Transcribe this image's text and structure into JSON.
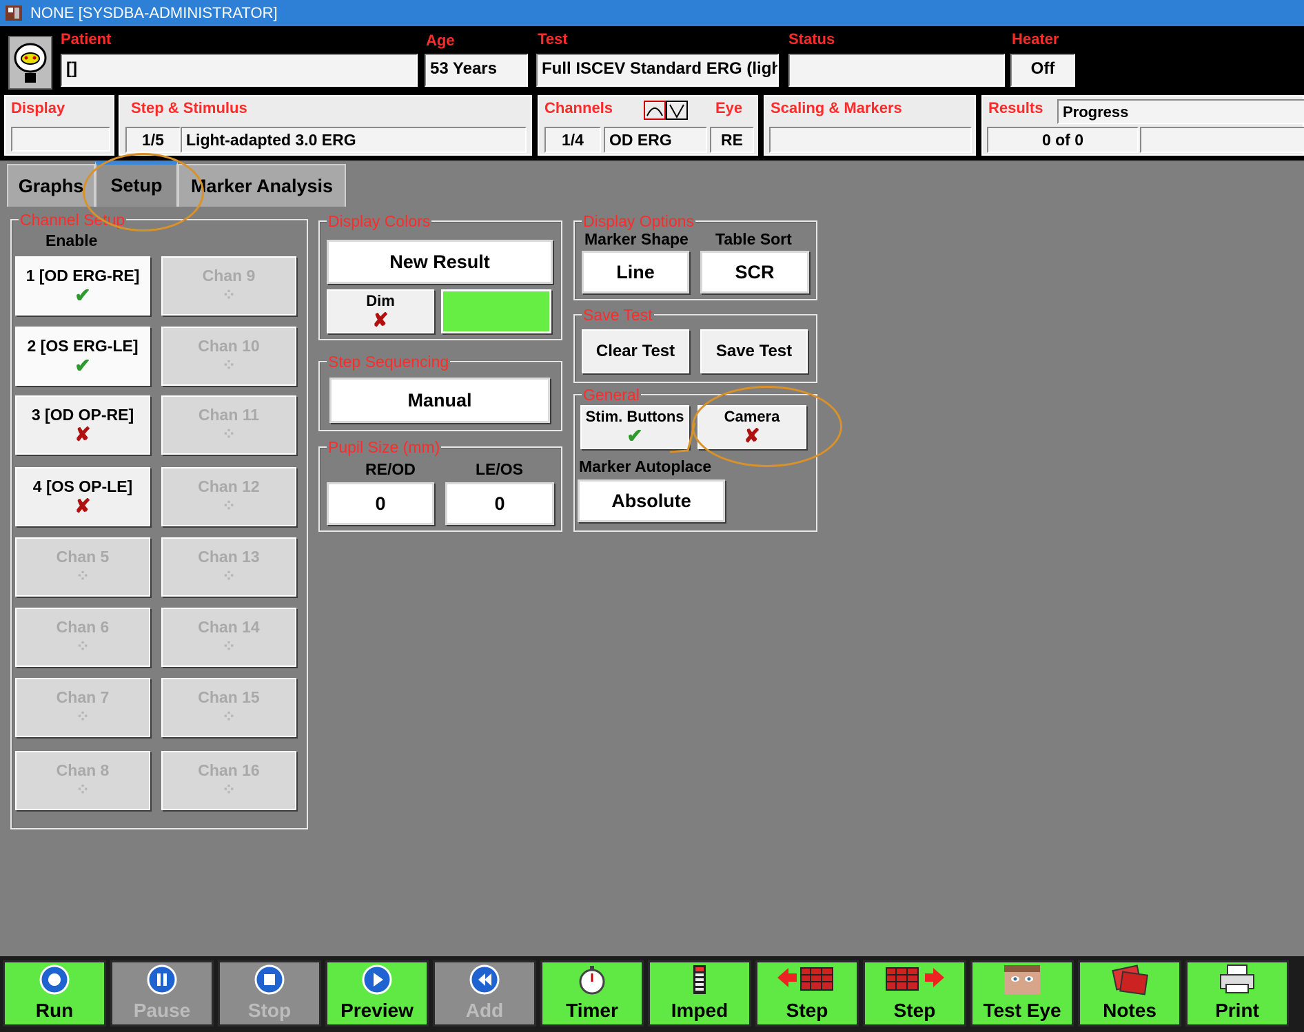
{
  "window": {
    "title": "NONE [SYSDBA-ADMINISTRATOR]"
  },
  "header": {
    "patient_label": "Patient",
    "patient_value": "[]",
    "age_label": "Age",
    "age_value": "53 Years",
    "test_label": "Test",
    "test_value": "Full ISCEV Standard ERG (ligh",
    "status_label": "Status",
    "status_value": "",
    "heater_label": "Heater",
    "heater_value": "Off",
    "display_label": "Display",
    "display_value": "",
    "step_label": "Step & Stimulus",
    "step_index": "1/5",
    "step_value": "Light-adapted 3.0 ERG",
    "channels_label": "Channels",
    "channel_index": "1/4",
    "channel_value": "OD ERG",
    "eye_label": "Eye",
    "eye_value": "RE",
    "scaling_label": "Scaling & Markers",
    "scaling_value": "",
    "results_label": "Results",
    "progress_label": "Progress",
    "results_value": "0 of 0",
    "results_extra": ""
  },
  "tabs": [
    {
      "label": "Graphs"
    },
    {
      "label": "Setup"
    },
    {
      "label": "Marker Analysis"
    }
  ],
  "channel_setup": {
    "title": "Channel Setup",
    "enable_label": "Enable",
    "left": [
      {
        "label": "1 [OD ERG-RE]",
        "state": "✔"
      },
      {
        "label": "2 [OS ERG-LE]",
        "state": "✔"
      },
      {
        "label": "3 [OD OP-RE]",
        "state": "✘"
      },
      {
        "label": "4 [OS OP-LE]",
        "state": "✘"
      },
      {
        "label": "Chan 5",
        "state": "⁘"
      },
      {
        "label": "Chan 6",
        "state": "⁘"
      },
      {
        "label": "Chan 7",
        "state": "⁘"
      },
      {
        "label": "Chan 8",
        "state": "⁘"
      }
    ],
    "right": [
      {
        "label": "Chan 9",
        "state": "⁘"
      },
      {
        "label": "Chan 10",
        "state": "⁘"
      },
      {
        "label": "Chan 11",
        "state": "⁘"
      },
      {
        "label": "Chan 12",
        "state": "⁘"
      },
      {
        "label": "Chan 13",
        "state": "⁘"
      },
      {
        "label": "Chan 14",
        "state": "⁘"
      },
      {
        "label": "Chan 15",
        "state": "⁘"
      },
      {
        "label": "Chan 16",
        "state": "⁘"
      }
    ]
  },
  "display_colors": {
    "title": "Display Colors",
    "new_result": "New Result",
    "dim_label": "Dim",
    "dim_state": "✘",
    "swatch_color": "#66ee44"
  },
  "step_sequencing": {
    "title": "Step Sequencing",
    "value": "Manual"
  },
  "pupil_size": {
    "title": "Pupil Size (mm)",
    "re_label": "RE/OD",
    "le_label": "LE/OS",
    "re_value": "0",
    "le_value": "0"
  },
  "display_options": {
    "title": "Display Options",
    "marker_shape_label": "Marker Shape",
    "marker_shape_value": "Line",
    "table_sort_label": "Table Sort",
    "table_sort_value": "SCR"
  },
  "save_test": {
    "title": "Save Test",
    "clear_label": "Clear Test",
    "save_label": "Save Test"
  },
  "general": {
    "title": "General",
    "stim_label": "Stim. Buttons",
    "stim_state": "✔",
    "camera_label": "Camera",
    "camera_state": "✘",
    "marker_autoplace_label": "Marker Autoplace",
    "marker_autoplace_value": "Absolute"
  },
  "toolbar": [
    {
      "label": "Run",
      "icon": "run-icon",
      "enabled": true
    },
    {
      "label": "Pause",
      "icon": "pause-icon",
      "enabled": false
    },
    {
      "label": "Stop",
      "icon": "stop-icon",
      "enabled": false
    },
    {
      "label": "Preview",
      "icon": "preview-icon",
      "enabled": true
    },
    {
      "label": "Add",
      "icon": "add-icon",
      "enabled": false
    },
    {
      "label": "Timer",
      "icon": "timer-icon",
      "enabled": true
    },
    {
      "label": "Imped",
      "icon": "impedance-icon",
      "enabled": true
    },
    {
      "label": "Step",
      "icon": "step-back-icon",
      "enabled": true
    },
    {
      "label": "Step",
      "icon": "step-forward-icon",
      "enabled": true
    },
    {
      "label": "Test Eye",
      "icon": "face-icon",
      "enabled": true
    },
    {
      "label": "Notes",
      "icon": "notes-icon",
      "enabled": true
    },
    {
      "label": "Print",
      "icon": "printer-icon",
      "enabled": true
    }
  ],
  "colors": {
    "titlebar": "#2e7fd6",
    "label_red": "#ff2a2a",
    "toolbar_green": "#60e844",
    "highlight": "#d9912a"
  }
}
